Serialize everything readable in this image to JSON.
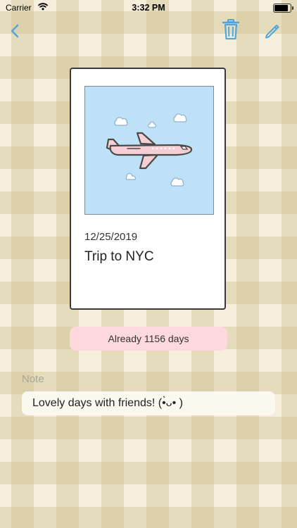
{
  "status_bar": {
    "carrier": "Carrier",
    "time": "3:32 PM"
  },
  "colors": {
    "accent": "#4fa6dc",
    "badge_bg": "#fdd8dc",
    "photo_bg": "#bfe1f7",
    "plane_body": "#f6cfd5",
    "background": "#f4eedb"
  },
  "nav": {
    "back_icon": "chevron-left-icon",
    "delete_icon": "trash-icon",
    "edit_icon": "pencil-icon"
  },
  "card": {
    "image_icon": "airplane-icon",
    "date": "12/25/2019",
    "title": "Trip to NYC"
  },
  "days_badge": {
    "text": "Already 1156 days"
  },
  "note": {
    "label": "Note",
    "text": "Lovely days with friends! (•̀ᴗ• )"
  }
}
